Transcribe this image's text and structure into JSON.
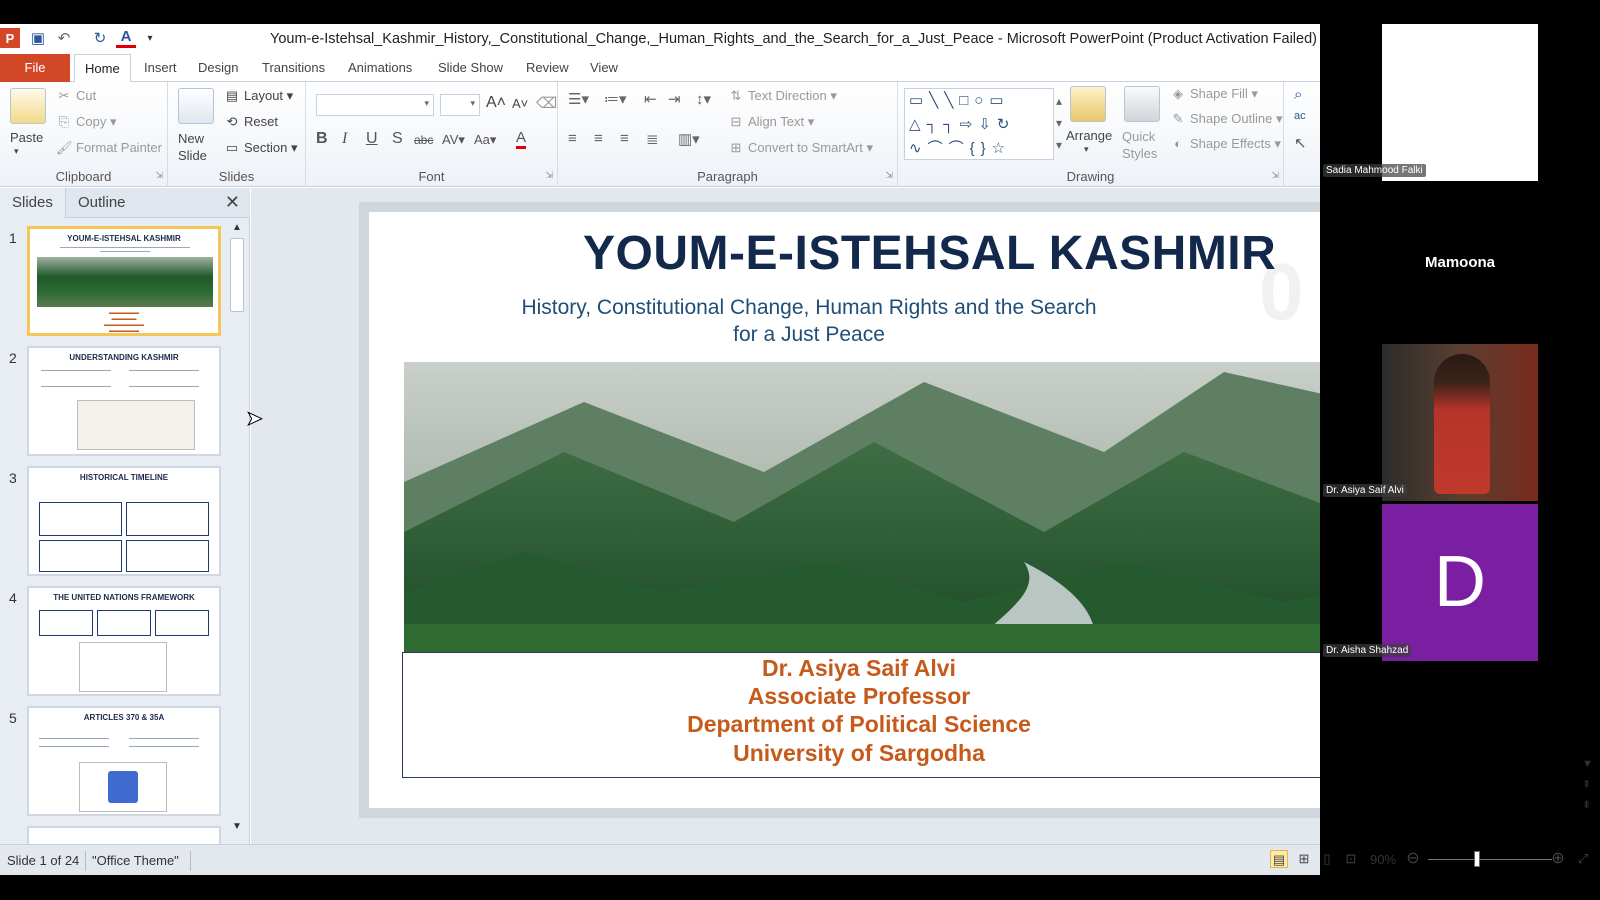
{
  "window": {
    "title": "Youm-e-Istehsal_Kashmir_History,_Constitutional_Change,_Human_Rights_and_the_Search_for_a_Just_Peace - Microsoft PowerPoint (Product Activation Failed)",
    "app_logo": "P"
  },
  "tabs": [
    "File",
    "Home",
    "Insert",
    "Design",
    "Transitions",
    "Animations",
    "Slide Show",
    "Review",
    "View"
  ],
  "ribbon": {
    "clipboard": {
      "label": "Clipboard",
      "paste": "Paste",
      "cut": "Cut",
      "copy": "Copy",
      "format_painter": "Format Painter"
    },
    "slides": {
      "label": "Slides",
      "new_slide": "New Slide",
      "layout": "Layout",
      "reset": "Reset",
      "section": "Section"
    },
    "font": {
      "label": "Font"
    },
    "paragraph": {
      "label": "Paragraph",
      "text_direction": "Text Direction",
      "align_text": "Align Text",
      "convert_smartart": "Convert to SmartArt"
    },
    "drawing": {
      "label": "Drawing",
      "arrange": "Arrange",
      "quick_styles": "Quick Styles",
      "shape_fill": "Shape Fill",
      "shape_outline": "Shape Outline",
      "shape_effects": "Shape Effects"
    }
  },
  "left_panel": {
    "tab_slides": "Slides",
    "tab_outline": "Outline",
    "thumbnails": [
      {
        "num": "1",
        "title": "YOUM-E-ISTEHSAL  KASHMIR"
      },
      {
        "num": "2",
        "title": "UNDERSTANDING KASHMIR"
      },
      {
        "num": "3",
        "title": "HISTORICAL TIMELINE"
      },
      {
        "num": "4",
        "title": "THE UNITED NATIONS FRAMEWORK"
      },
      {
        "num": "5",
        "title": "ARTICLES 370  & 35A"
      }
    ]
  },
  "slide": {
    "title": "YOUM-E-ISTEHSAL KASHMIR",
    "subtitle": "History, Constitutional Change, Human Rights and the Search for a Just Peace",
    "author_lines": [
      "Dr. Asiya Saif Alvi",
      "Associate Professor",
      "Department of Political Science",
      "University of Sargodha"
    ]
  },
  "status": {
    "slide_count": "Slide 1 of 24",
    "theme": "\"Office Theme\"",
    "zoom": "90%"
  },
  "participants": [
    {
      "name": "Sadia Mahmood Falki"
    },
    {
      "name": "Mamoona"
    },
    {
      "name": "Dr. Asiya Saif Alvi"
    },
    {
      "name": "Dr. Aisha Shahzad",
      "initial": "D"
    }
  ]
}
